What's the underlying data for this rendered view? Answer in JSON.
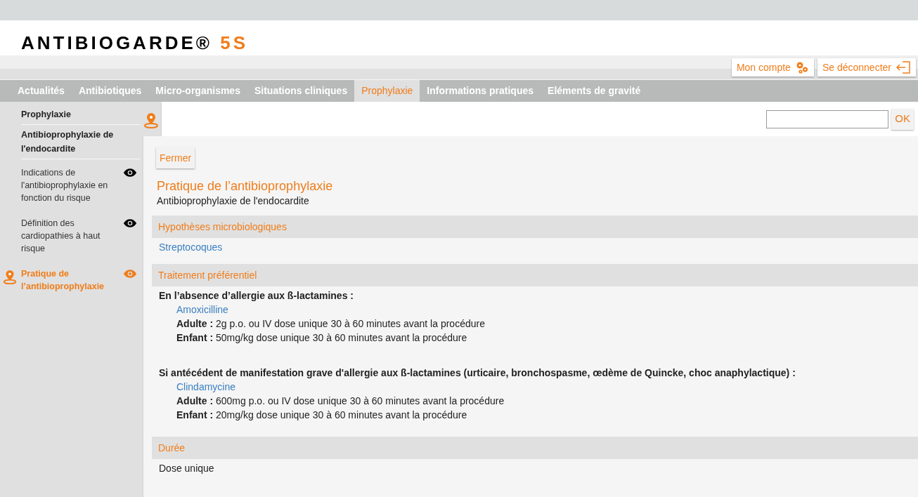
{
  "logo": {
    "name": "ANTIBIOGARDE®",
    "version": "5S"
  },
  "account_buttons": [
    {
      "label": "Mon compte",
      "kind": "gear"
    },
    {
      "label": "Se déconnecter",
      "kind": "logout"
    }
  ],
  "nav": [
    {
      "label": "Actualités",
      "selected": false
    },
    {
      "label": "Antibiotiques",
      "selected": false
    },
    {
      "label": "Micro-organismes",
      "selected": false
    },
    {
      "label": "Situations cliniques",
      "selected": false
    },
    {
      "label": "Prophylaxie",
      "selected": true
    },
    {
      "label": "Informations pratiques",
      "selected": false
    },
    {
      "label": "Eléments de gravité",
      "selected": false
    }
  ],
  "sidebar": {
    "breadcrumbs": [
      "Prophylaxie",
      "Antibioprophylaxie de l'endocardite"
    ],
    "items": [
      {
        "label": "Indications de l'antibioprophylaxie en fonction du risque",
        "selected": false
      },
      {
        "label": "Définition des cardiopathies à haut risque",
        "selected": false
      },
      {
        "label": "Pratique de l’antibioprophylaxie",
        "selected": true
      }
    ]
  },
  "search": {
    "button": "OK"
  },
  "close_button": "Fermer",
  "title": "Pratique de l’antibioprophylaxie",
  "subtitle": "Antibioprophylaxie de l'endocardite",
  "sections": [
    {
      "heading": "Hypothèses microbiologiques",
      "kind": "links",
      "links": [
        "Streptocoques"
      ]
    },
    {
      "heading": "Traitement préférentiel",
      "kind": "treatments",
      "groups": [
        {
          "condition": "En l’absence d’allergie aux ß-lactamines :",
          "drug": "Amoxicilline",
          "doses": [
            "**Adulte :** 2g p.o. ou IV dose unique 30 à 60 minutes avant la procédure",
            "**Enfant :** 50mg/kg dose unique 30 à 60 minutes avant la procédure"
          ]
        },
        {
          "condition": "Si antécédent de manifestation grave d'allergie aux ß-lactamines (urticaire, bronchospasme, œdème de Quincke, choc anaphylactique) :",
          "drug": "Clindamycine",
          "doses": [
            "**Adulte :** 600mg p.o. ou IV dose unique 30 à 60 minutes avant la procédure",
            "**Enfant :** 20mg/kg dose unique 30 à 60 minutes avant la procédure"
          ]
        }
      ]
    },
    {
      "heading": "Durée",
      "kind": "text",
      "text": "Dose unique"
    }
  ]
}
